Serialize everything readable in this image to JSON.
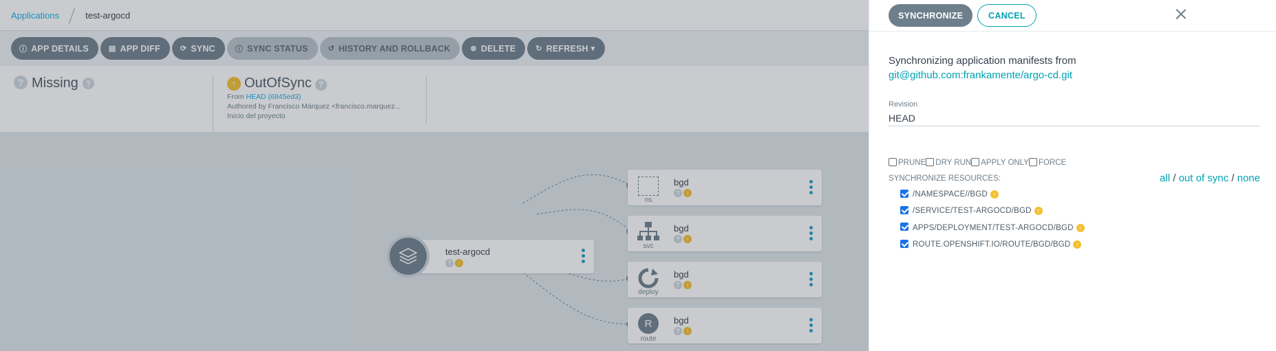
{
  "breadcrumb": {
    "root": "Applications",
    "current": "test-argocd"
  },
  "toolbar": {
    "buttons": [
      {
        "label": "APP DETAILS",
        "icon": "info-icon"
      },
      {
        "label": "APP DIFF",
        "icon": "file-icon"
      },
      {
        "label": "SYNC",
        "icon": "sync-icon"
      },
      {
        "label": "SYNC STATUS",
        "icon": "info-icon"
      },
      {
        "label": "HISTORY AND ROLLBACK",
        "icon": "history-icon"
      },
      {
        "label": "DELETE",
        "icon": "close-circle-icon"
      },
      {
        "label": "REFRESH",
        "icon": "refresh-icon"
      }
    ]
  },
  "status": {
    "health": "Missing",
    "sync": "OutOfSync",
    "from_label": "From",
    "revision": "HEAD (6845ed3)",
    "author": "Authored by Francisco Márquez <francisco.marquez...",
    "message": "Inicio del proyecto"
  },
  "graph": {
    "app_node": {
      "name": "test-argocd"
    },
    "resources": [
      {
        "name": "bgd",
        "kind": "ns"
      },
      {
        "name": "bgd",
        "kind": "svc"
      },
      {
        "name": "bgd",
        "kind": "deploy"
      },
      {
        "name": "bgd",
        "kind": "route"
      }
    ]
  },
  "panel": {
    "synchronize_label": "SYNCHRONIZE",
    "cancel_label": "CANCEL",
    "intro": "Synchronizing application manifests from",
    "repo": "git@github.com:frankamente/argo-cd.git",
    "revision_label": "Revision",
    "revision_value": "HEAD",
    "options": {
      "prune": "PRUNE",
      "dry_run": "DRY RUN",
      "apply_only": "APPLY ONLY",
      "force": "FORCE"
    },
    "resources_title": "SYNCHRONIZE RESOURCES:",
    "select_all": "all",
    "select_out_of_sync": "out of sync",
    "select_none": "none",
    "slash": "/",
    "resources": [
      "/NAMESPACE//BGD",
      "/SERVICE/TEST-ARGOCD/BGD",
      "APPS/DEPLOYMENT/TEST-ARGOCD/BGD",
      "ROUTE.OPENSHIFT.IO/ROUTE/BGD/BGD"
    ]
  },
  "colors": {
    "accent": "#00a2b3",
    "button_gray": "#6d7f8b",
    "out_of_sync": "#f4c030",
    "unknown": "#ccd6dd"
  }
}
